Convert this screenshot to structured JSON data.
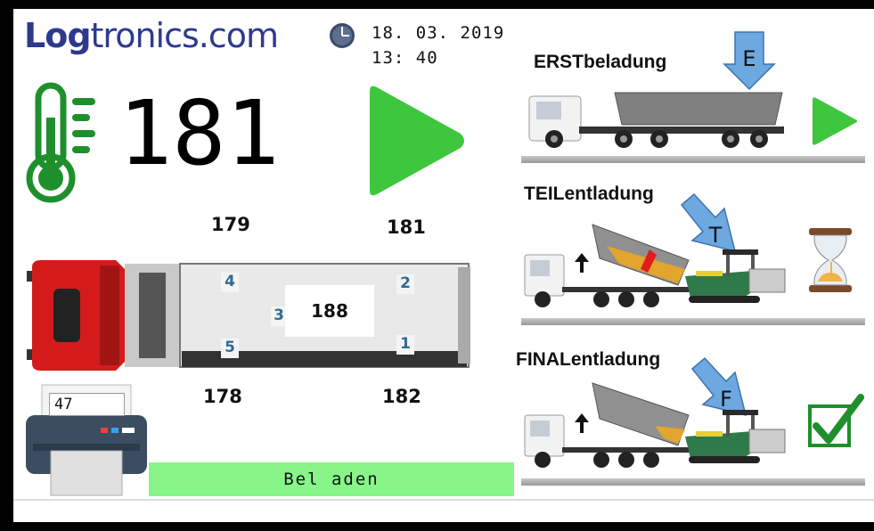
{
  "brand": {
    "part1": "Log",
    "part2": "tronics.com"
  },
  "datetime": {
    "date": "18. 03. 2019",
    "time": "13: 40"
  },
  "temperature": {
    "main": "181"
  },
  "sensors": {
    "s179": "179",
    "s181": "181",
    "s178": "178",
    "s182": "182",
    "center": "188"
  },
  "truck_slots": [
    "1",
    "2",
    "3",
    "4",
    "5"
  ],
  "printer": {
    "count": "47"
  },
  "status": {
    "label": "Bel aden"
  },
  "stages": [
    {
      "title": "ERSTbeladung",
      "marker": "E",
      "state": "play"
    },
    {
      "title": "TEILentladung",
      "marker": "T",
      "state": "hourglass"
    },
    {
      "title": "FINALentladung",
      "marker": "F",
      "state": "check"
    }
  ],
  "colors": {
    "brand": "#2d3a8c",
    "play": "#3fc63f",
    "status_bar": "#87f58a",
    "thermo": "#1e8f2c",
    "arrow": "#6ea8e0"
  }
}
